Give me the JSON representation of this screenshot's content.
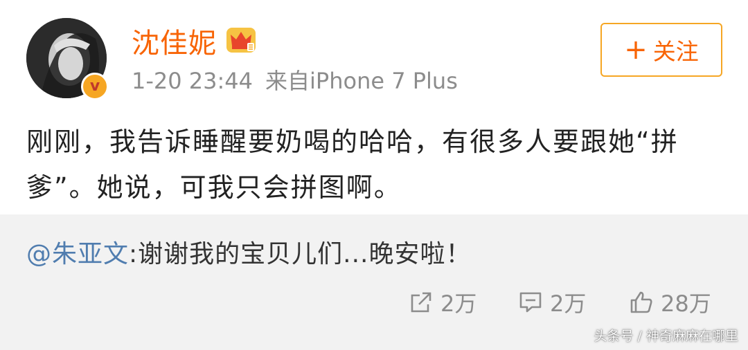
{
  "post": {
    "username": "沈佳妮",
    "time": "1-20 23:44",
    "source": "来自iPhone 7 Plus",
    "follow_label": "关注",
    "follow_plus": "+",
    "text": "刚刚，我告诉睡醒要奶喝的哈哈，有很多人要跟她“拼爹”。她说，可我只会拼图啊。",
    "verified_mark": "v"
  },
  "repost": {
    "mention": "@朱亚文",
    "text": ":谢谢我的宝贝儿们...晚安啦！"
  },
  "actions": {
    "forward_count": "2万",
    "comment_count": "2万",
    "like_count": "28万"
  },
  "icons": {
    "crown": "crown-icon",
    "forward": "forward-icon",
    "comment": "comment-icon",
    "like": "thumbs-up-icon"
  },
  "colors": {
    "username": "#f86405",
    "follow_border": "#f6a623",
    "mention": "#507daf",
    "meta": "#8c8c8c",
    "repost_bg": "#f2f2f2"
  },
  "watermark": "头条号 / 神奇麻麻在哪里"
}
